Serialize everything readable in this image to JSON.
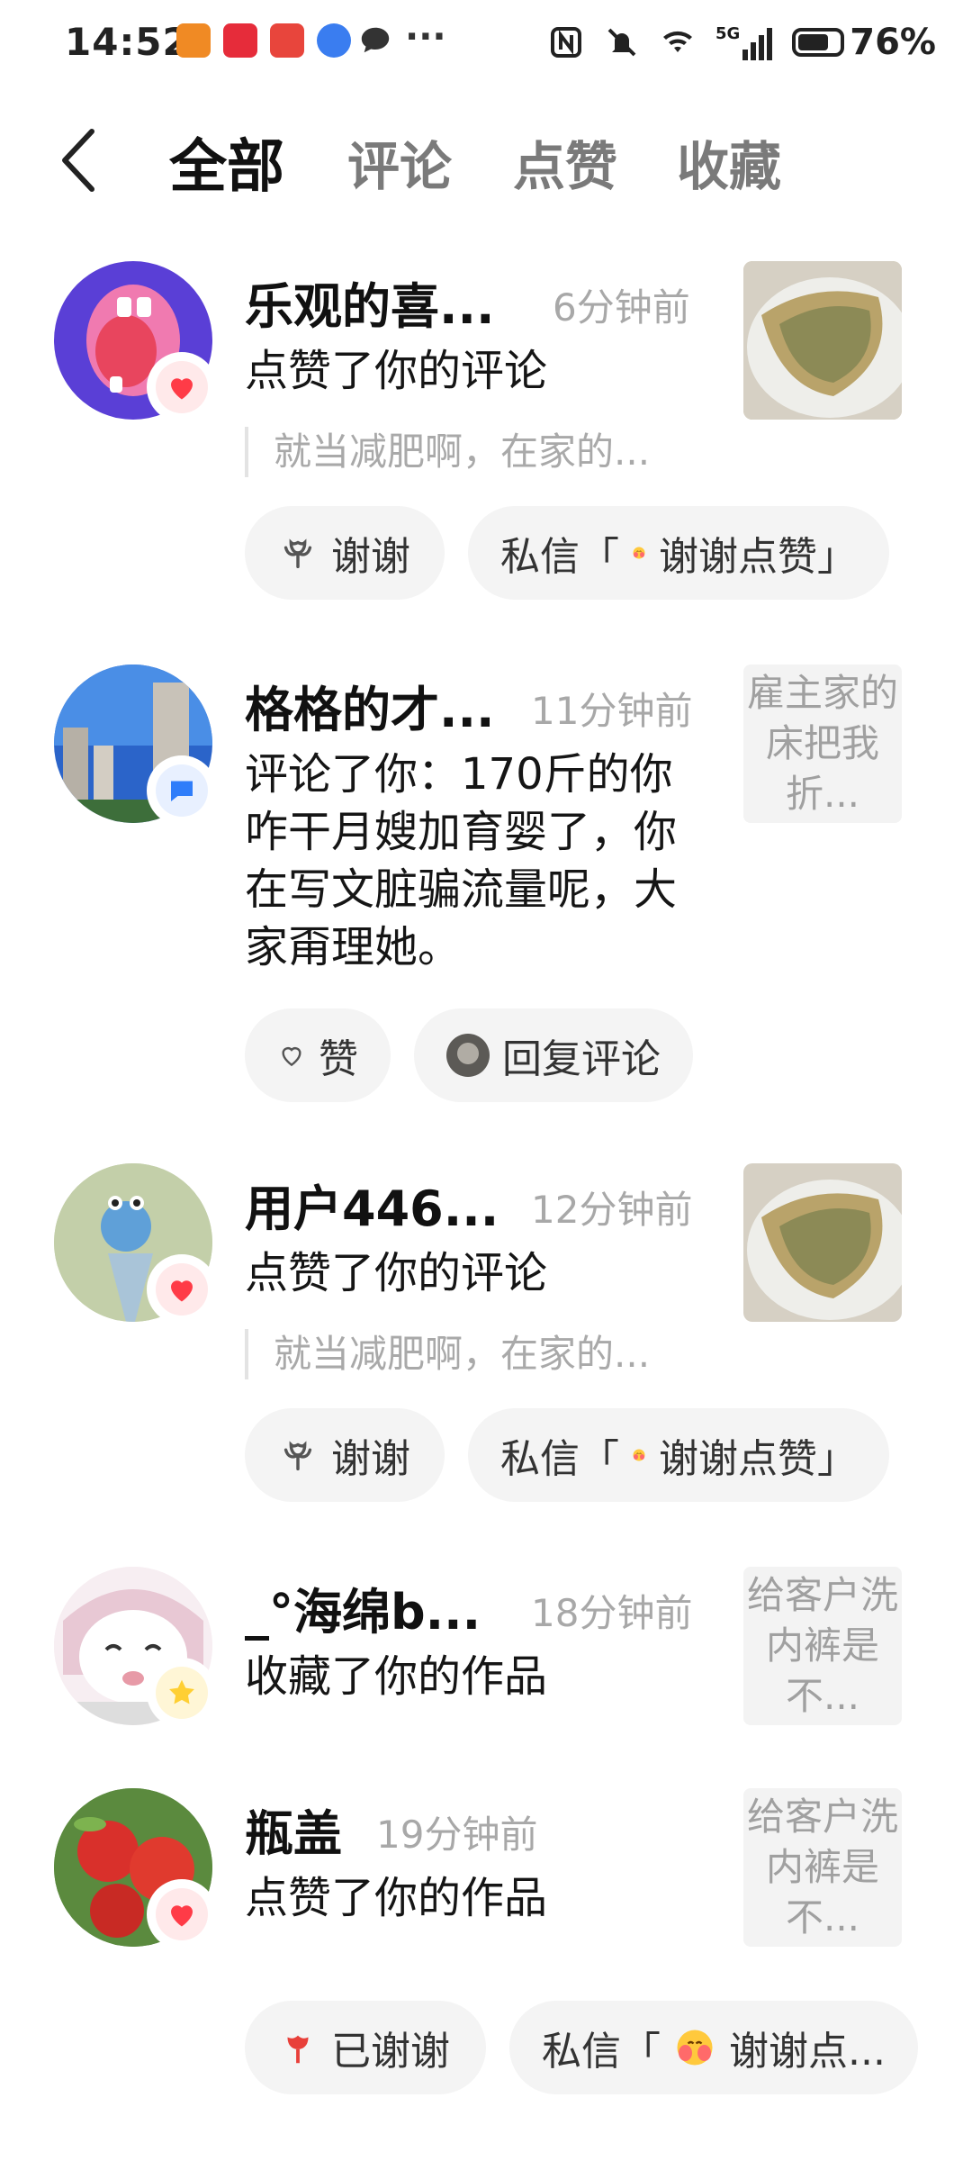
{
  "status_bar": {
    "time": "14:52",
    "network": "5G",
    "battery_percent": "76%",
    "battery_level": 0.76,
    "more_dots": "···"
  },
  "header": {
    "tabs": [
      {
        "label": "全部",
        "active": true
      },
      {
        "label": "评论",
        "active": false
      },
      {
        "label": "点赞",
        "active": false
      },
      {
        "label": "收藏",
        "active": false
      }
    ]
  },
  "notifications": [
    {
      "name": "乐观的喜...",
      "time": "6分钟前",
      "badge": "heart-icon",
      "action": "点赞了你的评论",
      "quote": "就当减肥啊，在家的...",
      "thumb": "food-image",
      "buttons": [
        {
          "icon": "thanks-flower-icon",
          "label": "谢谢"
        },
        {
          "label_prefix": "私信「",
          "emoji": "hug-emoji",
          "label_suffix": "谢谢点赞」"
        }
      ]
    },
    {
      "name": "格格的才...",
      "time": "11分钟前",
      "badge": "comment-icon",
      "action": "评论了你：170斤的你咋干月嫂加育婴了，你在写文脏骗流量呢，大家甭理她。",
      "thumb_text": "雇主家的床把我折...",
      "buttons": [
        {
          "icon": "heart-outline-icon",
          "label": "赞"
        },
        {
          "icon": "avatar-mini",
          "label": "回复评论"
        }
      ]
    },
    {
      "name": "用户446...",
      "time": "12分钟前",
      "badge": "heart-icon",
      "action": "点赞了你的评论",
      "quote": "就当减肥啊，在家的...",
      "thumb": "food-image",
      "buttons": [
        {
          "icon": "thanks-flower-icon",
          "label": "谢谢"
        },
        {
          "label_prefix": "私信「",
          "emoji": "hug-emoji",
          "label_suffix": "谢谢点赞」"
        }
      ]
    },
    {
      "name": "_°海绵b...",
      "time": "18分钟前",
      "badge": "star-icon",
      "action": "收藏了你的作品",
      "thumb_text": "给客户洗内裤是不..."
    },
    {
      "name": "瓶盖",
      "time": "19分钟前",
      "badge": "heart-icon",
      "action": "点赞了你的作品",
      "thumb_text": "给客户洗内裤是不...",
      "buttons": [
        {
          "icon": "thanked-flower-icon",
          "label": "已谢谢"
        },
        {
          "label_prefix": "私信「",
          "emoji": "hug-emoji",
          "label_suffix": "谢谢点..."
        }
      ]
    }
  ],
  "colors": {
    "heart": "#ff3b47",
    "comment_badge": "#2f7dfa",
    "star_badge": "#ffcf33",
    "pill_bg": "#f4f4f4",
    "muted_text": "#a8a8a8"
  }
}
